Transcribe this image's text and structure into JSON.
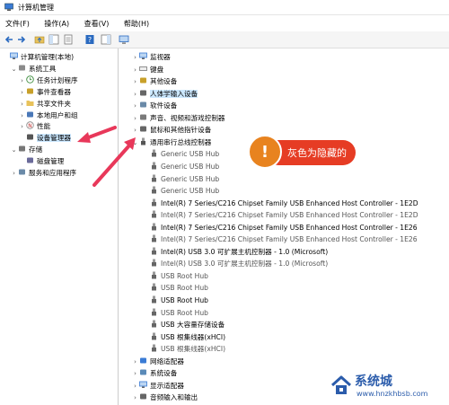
{
  "window": {
    "title": "计算机管理"
  },
  "menu": [
    "文件(F)",
    "操作(A)",
    "查看(V)",
    "帮助(H)"
  ],
  "left_tree": [
    {
      "label": "计算机管理(本地)",
      "arrow": "",
      "icon": "computer",
      "indent": 0
    },
    {
      "label": "系统工具",
      "arrow": "⌄",
      "icon": "tools",
      "indent": 1
    },
    {
      "label": "任务计划程序",
      "arrow": "›",
      "icon": "clock",
      "indent": 2
    },
    {
      "label": "事件查看器",
      "arrow": "›",
      "icon": "event",
      "indent": 2
    },
    {
      "label": "共享文件夹",
      "arrow": "›",
      "icon": "folder",
      "indent": 2
    },
    {
      "label": "本地用户和组",
      "arrow": "›",
      "icon": "users",
      "indent": 2
    },
    {
      "label": "性能",
      "arrow": "›",
      "icon": "perf",
      "indent": 2
    },
    {
      "label": "设备管理器",
      "arrow": "",
      "icon": "devmgr",
      "indent": 2,
      "selected": true
    },
    {
      "label": "存储",
      "arrow": "⌄",
      "icon": "storage",
      "indent": 1
    },
    {
      "label": "磁盘管理",
      "arrow": "",
      "icon": "disk",
      "indent": 2
    },
    {
      "label": "服务和应用程序",
      "arrow": "›",
      "icon": "services",
      "indent": 1
    }
  ],
  "right_tree": [
    {
      "label": "监视器",
      "arrow": "›",
      "icon": "monitor",
      "indent": 0
    },
    {
      "label": "键盘",
      "arrow": "›",
      "icon": "keyboard",
      "indent": 0
    },
    {
      "label": "其他设备",
      "arrow": "›",
      "icon": "other",
      "indent": 0
    },
    {
      "label": "人体学输入设备",
      "arrow": "›",
      "icon": "hid",
      "indent": 0,
      "selected": true
    },
    {
      "label": "软件设备",
      "arrow": "›",
      "icon": "software",
      "indent": 0
    },
    {
      "label": "声音、视频和游戏控制器",
      "arrow": "›",
      "icon": "sound",
      "indent": 0
    },
    {
      "label": "鼠标和其他指针设备",
      "arrow": "›",
      "icon": "mouse",
      "indent": 0
    },
    {
      "label": "通用串行总线控制器",
      "arrow": "⌄",
      "icon": "usb",
      "indent": 0
    },
    {
      "label": "Generic USB Hub",
      "icon": "usb-dev",
      "indent": 1,
      "hidden": true
    },
    {
      "label": "Generic USB Hub",
      "icon": "usb-dev",
      "indent": 1,
      "hidden": true
    },
    {
      "label": "Generic USB Hub",
      "icon": "usb-dev",
      "indent": 1,
      "hidden": true
    },
    {
      "label": "Generic USB Hub",
      "icon": "usb-dev",
      "indent": 1,
      "hidden": true
    },
    {
      "label": "Intel(R) 7 Series/C216 Chipset Family USB Enhanced Host Controller - 1E2D",
      "icon": "usb-dev",
      "indent": 1
    },
    {
      "label": "Intel(R) 7 Series/C216 Chipset Family USB Enhanced Host Controller - 1E2D",
      "icon": "usb-dev",
      "indent": 1,
      "hidden": true
    },
    {
      "label": "Intel(R) 7 Series/C216 Chipset Family USB Enhanced Host Controller - 1E26",
      "icon": "usb-dev",
      "indent": 1
    },
    {
      "label": "Intel(R) 7 Series/C216 Chipset Family USB Enhanced Host Controller - 1E26",
      "icon": "usb-dev",
      "indent": 1,
      "hidden": true
    },
    {
      "label": "Intel(R) USB 3.0 可扩展主机控制器 - 1.0 (Microsoft)",
      "icon": "usb-dev",
      "indent": 1
    },
    {
      "label": "Intel(R) USB 3.0 可扩展主机控制器 - 1.0 (Microsoft)",
      "icon": "usb-dev",
      "indent": 1,
      "hidden": true
    },
    {
      "label": "USB Root Hub",
      "icon": "usb-dev",
      "indent": 1,
      "hidden": true
    },
    {
      "label": "USB Root Hub",
      "icon": "usb-dev",
      "indent": 1,
      "hidden": true
    },
    {
      "label": "USB Root Hub",
      "icon": "usb-dev",
      "indent": 1
    },
    {
      "label": "USB Root Hub",
      "icon": "usb-dev",
      "indent": 1,
      "hidden": true
    },
    {
      "label": "USB 大容量存储设备",
      "icon": "usb-dev",
      "indent": 1
    },
    {
      "label": "USB 根集线器(xHCI)",
      "icon": "usb-dev",
      "indent": 1
    },
    {
      "label": "USB 根集线器(xHCI)",
      "icon": "usb-dev",
      "indent": 1,
      "hidden": true
    },
    {
      "label": "网络适配器",
      "arrow": "›",
      "icon": "network",
      "indent": 0
    },
    {
      "label": "系统设备",
      "arrow": "›",
      "icon": "system",
      "indent": 0
    },
    {
      "label": "显示适配器",
      "arrow": "›",
      "icon": "display",
      "indent": 0
    },
    {
      "label": "音频输入和输出",
      "arrow": "›",
      "icon": "audio",
      "indent": 0
    }
  ],
  "callout": {
    "text": "灰色为隐藏的",
    "badge": "!"
  },
  "watermark": {
    "text": "系统城",
    "url": "www.hnzkhbsb.com"
  },
  "colors": {
    "selection": "#cce8ff",
    "arrow": "#e8385a",
    "callout_bubble": "#e63c24",
    "callout_circle": "#e8831f",
    "hidden_text": "#555555"
  }
}
